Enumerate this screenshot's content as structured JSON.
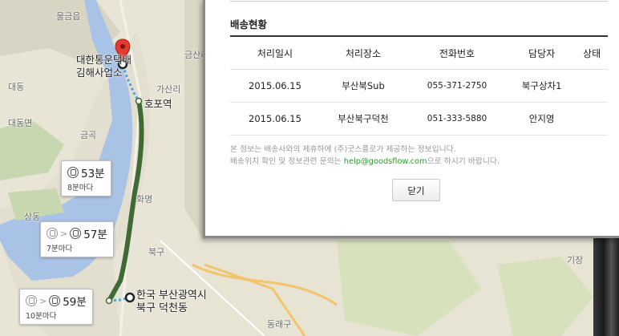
{
  "map": {
    "places": {
      "mulgeum": "물금읍",
      "daedong": "대동",
      "hopo_station": "호포역",
      "gasan": "가산리",
      "geumsan": "금산리",
      "dongnae": "동래구",
      "bukgu": "북구",
      "gijang": "기장",
      "geumgok": "금곡",
      "hwamyeong": "화명",
      "daedong2": "대동면",
      "sangdong": "상동"
    },
    "origin_label_line1": "대한통운택배",
    "origin_label_line2": "김해사업소",
    "dest_label_line1": "한국 부산광역시",
    "dest_label_line2": "북구 덕천동",
    "routes": [
      {
        "minutes": "53분",
        "frequency": "8분마다",
        "modes": [
          "bus"
        ]
      },
      {
        "minutes": "57분",
        "frequency": "7분마다",
        "modes": [
          "bus-gray",
          "bus"
        ]
      },
      {
        "minutes": "59분",
        "frequency": "10분마다",
        "modes": [
          "bus-gray",
          "bus"
        ]
      }
    ],
    "route_color": "#3e6b35"
  },
  "dialog": {
    "title": "배송현황",
    "columns": [
      "처리일시",
      "처리장소",
      "전화번호",
      "담당자",
      "상태"
    ],
    "rows": [
      [
        "2015.06.15",
        "부산북Sub",
        "055-371-2750",
        "북구상차1",
        ""
      ],
      [
        "2015.06.15",
        "부산북구덕천",
        "051-333-5880",
        "안지영",
        ""
      ]
    ],
    "note_line1": "본 정보는 배송사와의 제휴하에 (주)굿스플로가 제공하는 정보입니다.",
    "note_line2_prefix": "배송위치 확인 및 정보관련 문의는 ",
    "note_email": "help@goodsflow.com",
    "note_line2_suffix": "으로 하시기 바랍니다.",
    "close_label": "닫기"
  }
}
